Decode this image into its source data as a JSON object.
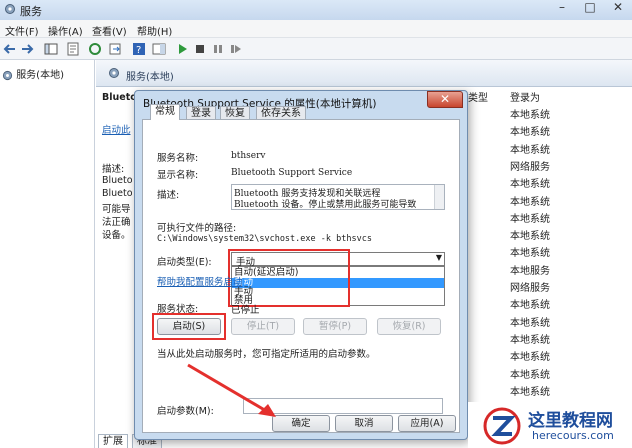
{
  "window": {
    "title": "服务",
    "minimize": "–",
    "maximize": "□",
    "close": "✕"
  },
  "menu": [
    "文件(F)",
    "操作(A)",
    "查看(V)",
    "帮助(H)"
  ],
  "left_pane": {
    "item": "服务(本地)"
  },
  "right_header": {
    "label": "服务(本地)"
  },
  "columns": {
    "type": "类型",
    "logon": "登录为"
  },
  "desc_text": [
    "Blueto",
    "启动此",
    "描述:",
    "Blueto",
    "Blueto",
    "可能导",
    "法正确",
    "设备。"
  ],
  "logon_rows": [
    "本地系统",
    "本地系统",
    "本地系统",
    "网络服务",
    "本地系统",
    "本地系统",
    "本地系统",
    "本地系统",
    "本地系统",
    "本地服务",
    "网络服务",
    "本地系统",
    "本地系统",
    "本地系统",
    "本地系统",
    "本地系统",
    "本地系统",
    "本地服务"
  ],
  "bottom_tabs": [
    "扩展",
    "标准"
  ],
  "dialog": {
    "title": "Bluetooth Support Service 的属性(本地计算机)",
    "close": "✕",
    "tabs": [
      "常规",
      "登录",
      "恢复",
      "依存关系"
    ],
    "service_name_label": "服务名称:",
    "service_name": "bthserv",
    "display_name_label": "显示名称:",
    "display_name": "Bluetooth Support Service",
    "description_label": "描述:",
    "description_lines": [
      "Bluetooth 服务支持发现和关联远程",
      "Bluetooth 设备。停止或禁用此服务可能导致"
    ],
    "exe_path_label": "可执行文件的路径:",
    "exe_path": "C:\\Windows\\system32\\svchost.exe -k bthsvcs",
    "startup_type_label": "启动类型(E):",
    "startup_type_value": "手动",
    "startup_options": [
      "自动(延迟启动)",
      "自动",
      "手动",
      "禁用"
    ],
    "help_link": "帮助我配置服务启动",
    "service_status_label": "服务状态:",
    "service_status_value": "已停止",
    "buttons": {
      "start": "启动(S)",
      "stop": "停止(T)",
      "pause": "暂停(P)",
      "resume": "恢复(R)"
    },
    "hint": "当从此处启动服务时，您可指定所适用的启动参数。",
    "start_params_label": "启动参数(M):",
    "ok": "确定",
    "cancel": "取消",
    "apply": "应用(A)"
  },
  "watermark": {
    "title": "这里教程网",
    "url": "herecours.com"
  }
}
